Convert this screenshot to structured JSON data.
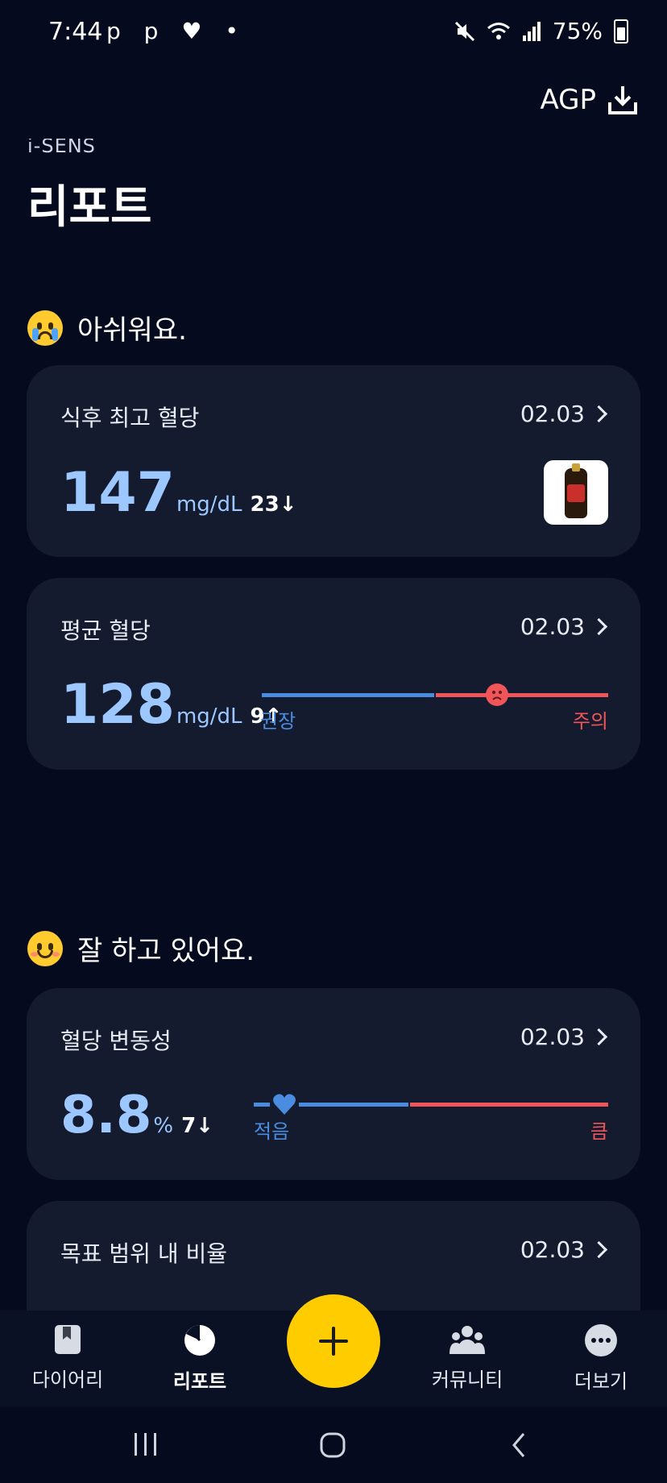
{
  "status_bar": {
    "time": "7:44",
    "left_icons": "p p ♥ •",
    "battery": "75%"
  },
  "header": {
    "agp_label": "AGP",
    "brand": "i-SENS",
    "title": "리포트"
  },
  "sections": [
    {
      "heading": "아쉬워요.",
      "emoji": "crying-face",
      "cards": [
        {
          "title": "식후 최고 혈당",
          "date": "02.03",
          "value": "147",
          "unit": "mg/dL",
          "delta": "23↓",
          "thumbnail": "drink-bottle"
        },
        {
          "title": "평균 혈당",
          "date": "02.03",
          "value": "128",
          "unit": "mg/dL",
          "delta": "9↑",
          "scale": {
            "low_label": "권장",
            "high_label": "주의",
            "level": 0.63
          }
        }
      ]
    },
    {
      "heading": "잘 하고 있어요.",
      "emoji": "smiling-face",
      "cards": [
        {
          "title": "혈당 변동성",
          "date": "02.03",
          "value": "8.8",
          "unit": "%",
          "delta": "7↓",
          "scale": {
            "low_label": "적음",
            "high_label": "큼",
            "level": 0.08
          }
        },
        {
          "title": "목표 범위 내 비율",
          "date": "02.03"
        }
      ]
    }
  ],
  "bottom_nav": {
    "items": [
      {
        "label": "다이어리",
        "icon": "book-icon"
      },
      {
        "label": "리포트",
        "icon": "report-pie-icon",
        "active": true
      },
      {
        "label": "커뮤니티",
        "icon": "community-icon"
      },
      {
        "label": "더보기",
        "icon": "more-icon"
      }
    ],
    "fab_icon": "plus-icon"
  },
  "colors": {
    "background": "#050a1e",
    "card": "#141b2e",
    "value_blue": "#9cc7ff",
    "scale_blue": "#4a8de0",
    "scale_red": "#f0555a",
    "fab": "#ffcc00"
  }
}
